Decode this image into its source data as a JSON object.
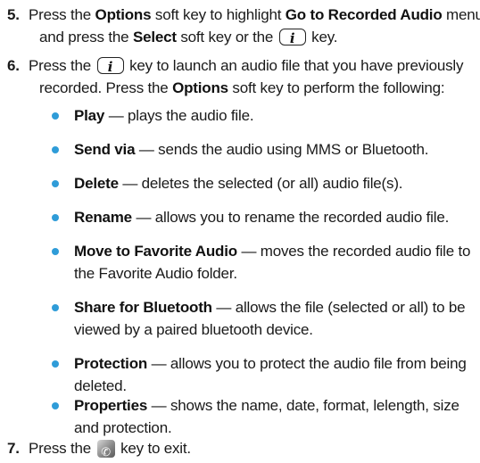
{
  "steps": [
    {
      "number": "5.",
      "line1_pre": "Press the ",
      "line1_b1": "Options",
      "line1_mid": " soft key to highlight ",
      "line1_b2": "Go to Recorded Audio",
      "line1_post": " menu",
      "line2_pre": "and press the ",
      "line2_b1": "Select",
      "line2_mid": " soft key or the ",
      "line2_post": " key."
    },
    {
      "number": "6.",
      "line1_pre": "Press the ",
      "line1_post": " key to launch an audio file that you have previously",
      "line2_pre": "recorded. Press the ",
      "line2_b1": "Options",
      "line2_post": " soft key to perform the following:"
    },
    {
      "number": "7.",
      "line1_pre": "Press the ",
      "line1_post": " key to exit."
    }
  ],
  "bullets": [
    {
      "term": "Play",
      "desc": " — plays the audio file.",
      "cont": ""
    },
    {
      "term": "Send via",
      "desc": " — sends the audio using MMS or Bluetooth.",
      "cont": ""
    },
    {
      "term": "Delete",
      "desc": " — deletes the selected (or all) audio file(s).",
      "cont": ""
    },
    {
      "term": "Rename",
      "desc": " — allows you to rename the recorded audio file.",
      "cont": ""
    },
    {
      "term": "Move to Favorite Audio",
      "desc": " — moves the recorded audio file to",
      "cont": "the Favorite Audio folder."
    },
    {
      "term": "Share for Bluetooth",
      "desc": " — allows the file (selected or all) to be",
      "cont": "viewed by a paired bluetooth device."
    },
    {
      "term": "Protection",
      "desc": " — allows you to protect the audio file from being",
      "cont": "deleted."
    },
    {
      "term": "Properties",
      "desc": " — shows the name, date, format, lelength, size",
      "cont": "and protection."
    }
  ],
  "icons": {
    "info_key": "i",
    "end_key": "end-call-icon"
  },
  "colors": {
    "bullet": "#2f9cd8",
    "text": "#1a1a1a"
  }
}
